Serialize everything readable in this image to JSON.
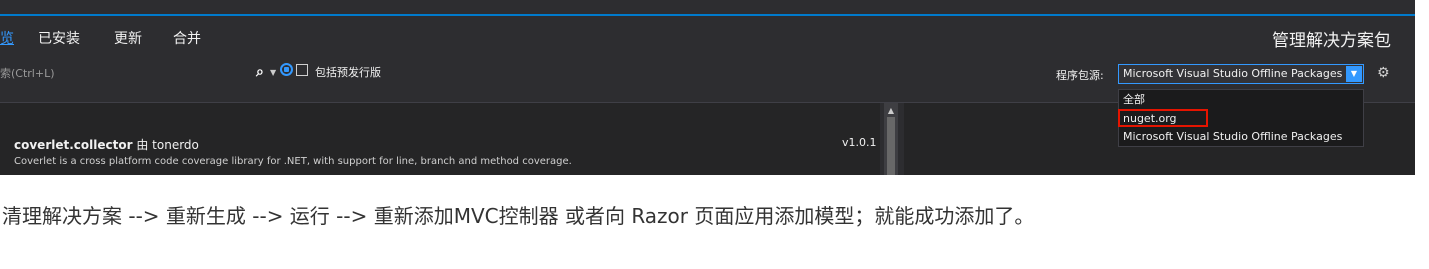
{
  "tabs": [
    {
      "label": "览"
    },
    {
      "label": "已安装"
    },
    {
      "label": "更新"
    },
    {
      "label": "合并"
    }
  ],
  "header": {
    "title": "管理解决方案包"
  },
  "search": {
    "placeholder": "索(Ctrl+L)",
    "include_prerelease_label": "包括预发行版"
  },
  "package_source": {
    "label": "程序包源:",
    "selected": "Microsoft Visual Studio Offline Packages",
    "options": [
      "全部",
      "nuget.org",
      "Microsoft Visual Studio Offline Packages"
    ]
  },
  "packages": [
    {
      "name": "coverlet.collector",
      "author": "由 tonerdo",
      "version": "v1.0.1",
      "description": "Coverlet is a cross platform code coverage library for .NET, with support for line, branch and method coverage."
    }
  ],
  "caption": "清理解决方案 --> 重新生成 --> 运行 --> 重新添加MVC控制器 或者向 Razor 页面应用添加模型；就能成功添加了。",
  "colors": {
    "accent": "#007acc",
    "highlight_border": "#e51400",
    "background": "#2d2d30"
  }
}
